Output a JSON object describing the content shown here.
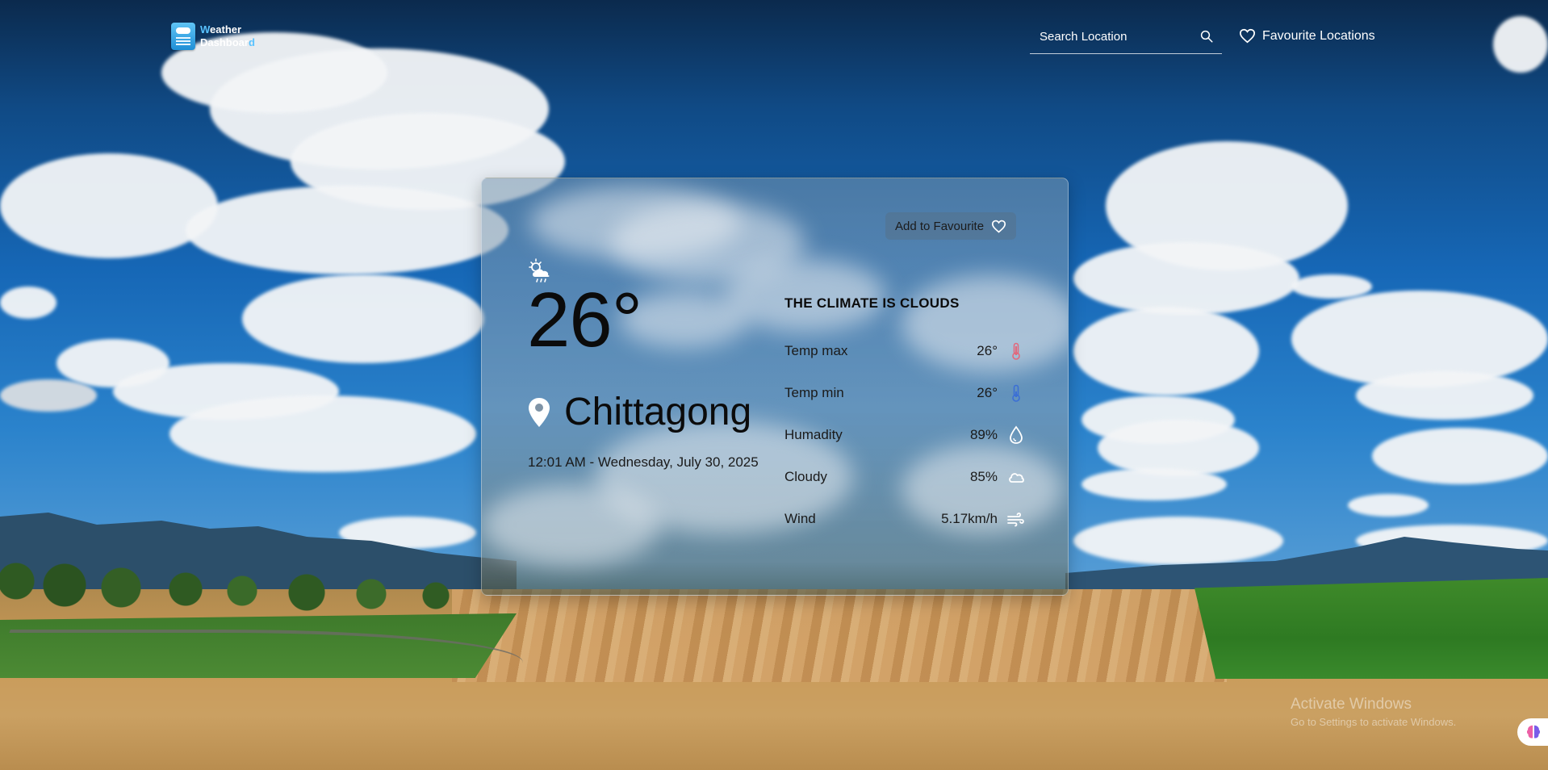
{
  "app": {
    "logo_line1_hl": "W",
    "logo_line1_rest": "eather",
    "logo_line2_rest": "Dashboar",
    "logo_line2_hl": "d"
  },
  "header": {
    "search_placeholder": "Search Location",
    "favourites_label": "Favourite Locations"
  },
  "card": {
    "add_favourite_label": "Add to Favourite",
    "temperature": "26°",
    "city": "Chittagong",
    "datetime": "12:01 AM - Wednesday, July 30, 2025",
    "climate_heading": "THE CLIMATE IS CLOUDS",
    "stats": [
      {
        "label": "Temp max",
        "value": "26°",
        "icon": "thermometer-hot-icon",
        "color": "#e2687c"
      },
      {
        "label": "Temp min",
        "value": "26°",
        "icon": "thermometer-cold-icon",
        "color": "#3b6fd6"
      },
      {
        "label": "Humadity",
        "value": "89%",
        "icon": "droplet-icon",
        "color": "#ffffff"
      },
      {
        "label": "Cloudy",
        "value": "85%",
        "icon": "cloud-icon",
        "color": "#ffffff"
      },
      {
        "label": "Wind",
        "value": "5.17km/h",
        "icon": "wind-icon",
        "color": "#ffffff"
      }
    ]
  },
  "watermark": {
    "line1": "Activate Windows",
    "line2": "Go to Settings to activate Windows."
  },
  "colors": {
    "accent": "#59c2ff",
    "text_dark": "#0b0b0b"
  }
}
